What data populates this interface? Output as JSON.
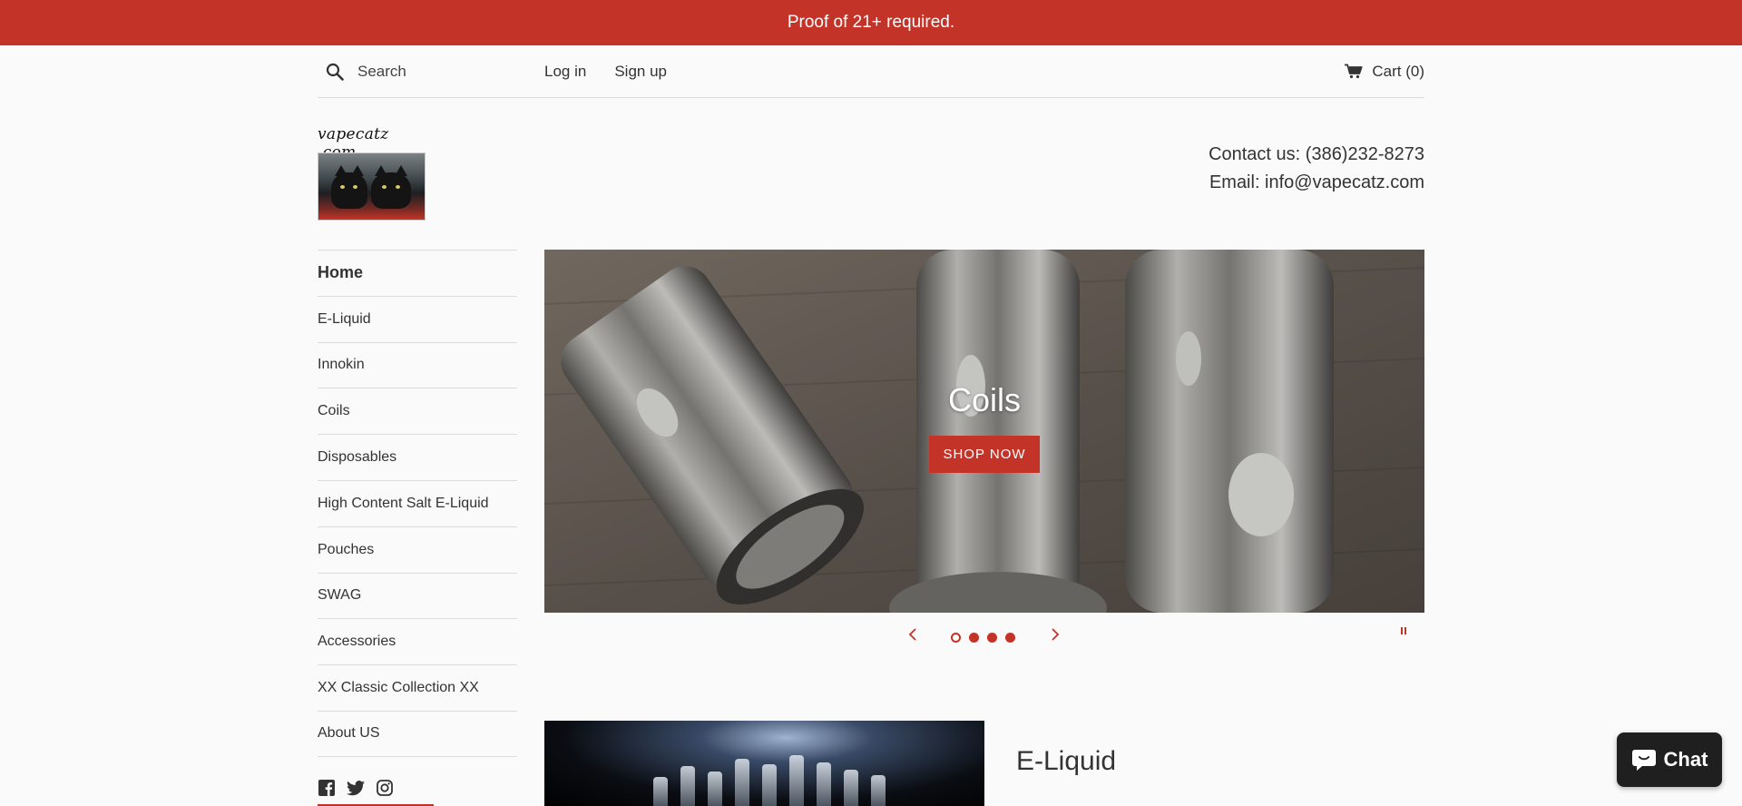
{
  "announcement": {
    "text": "Proof of 21+ required."
  },
  "header": {
    "search_placeholder": "Search",
    "login_label": "Log in",
    "signup_label": "Sign up",
    "cart_label": "Cart (0)"
  },
  "logo": {
    "text": "vapecatz .com"
  },
  "contact": {
    "phone": "Contact us: (386)232-8273",
    "email": "Email: info@vapecatz.com"
  },
  "sidebar": {
    "items": [
      {
        "label": "Home",
        "active": true
      },
      {
        "label": "E-Liquid"
      },
      {
        "label": "Innokin"
      },
      {
        "label": "Coils"
      },
      {
        "label": "Disposables"
      },
      {
        "label": "High Content Salt E-Liquid"
      },
      {
        "label": "Pouches"
      },
      {
        "label": "SWAG"
      },
      {
        "label": "Accessories"
      },
      {
        "label": "XX Classic Collection XX"
      },
      {
        "label": "About US"
      }
    ],
    "social": [
      "facebook-icon",
      "twitter-icon",
      "instagram-icon"
    ]
  },
  "slideshow": {
    "title": "Coils",
    "button_label": "SHOP NOW",
    "slide_count": 4,
    "active_slide": 1
  },
  "feature": {
    "title": "E-Liquid"
  },
  "chat": {
    "label": "Chat"
  },
  "colors": {
    "accent": "#c43327",
    "background": "#fafafa",
    "text": "#333333",
    "chat_bg": "#1f1f1f"
  }
}
